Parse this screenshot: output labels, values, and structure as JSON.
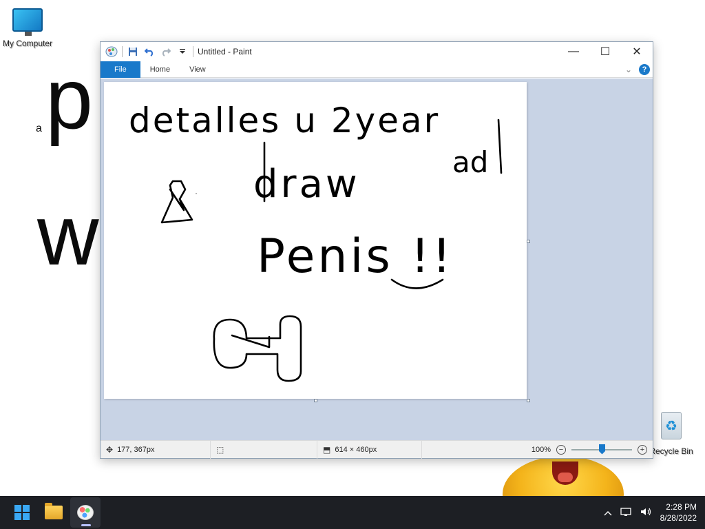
{
  "desktop": {
    "wall_letter_p": "p",
    "wall_letter_a": "a",
    "wall_letter_w": "w",
    "icons": {
      "my_computer": "My Computer",
      "recycle_bin": "Recycle Bin"
    }
  },
  "window": {
    "title": "Untitled - Paint",
    "quick_access": {
      "app_icon": "paint-palette-icon",
      "save_icon": "save-icon",
      "undo_icon": "undo-icon",
      "redo_icon": "redo-icon",
      "customize_icon": "dropdown-icon"
    },
    "controls": {
      "minimize": "—",
      "maximize": "☐",
      "close": "✕"
    },
    "ribbon": {
      "tabs": [
        "File",
        "Home",
        "View"
      ],
      "collapse_icon": "⌄",
      "help": "?"
    },
    "status": {
      "cursor_position": "177, 367px",
      "selection_size": "",
      "image_size": "614 × 460px",
      "zoom_level": "100%",
      "zoom_fraction": 0.5
    },
    "canvas_text": [
      "detalles u 2year",
      "ad",
      "draw",
      "Penis !!"
    ]
  },
  "taskbar": {
    "apps": [
      {
        "name": "start",
        "icon": "windows-logo-icon"
      },
      {
        "name": "file-explorer",
        "icon": "folder-icon"
      },
      {
        "name": "paint",
        "icon": "paint-palette-icon",
        "active": true
      }
    ],
    "tray": {
      "chevron": "^",
      "network_icon": "network-icon",
      "volume_icon": "volume-icon",
      "time": "2:28 PM",
      "date": "8/28/2022"
    }
  },
  "colors": {
    "ribbon_accent": "#1979ca",
    "workspace_bg": "#c8d3e5",
    "taskbar_bg": "#1d1f24"
  }
}
